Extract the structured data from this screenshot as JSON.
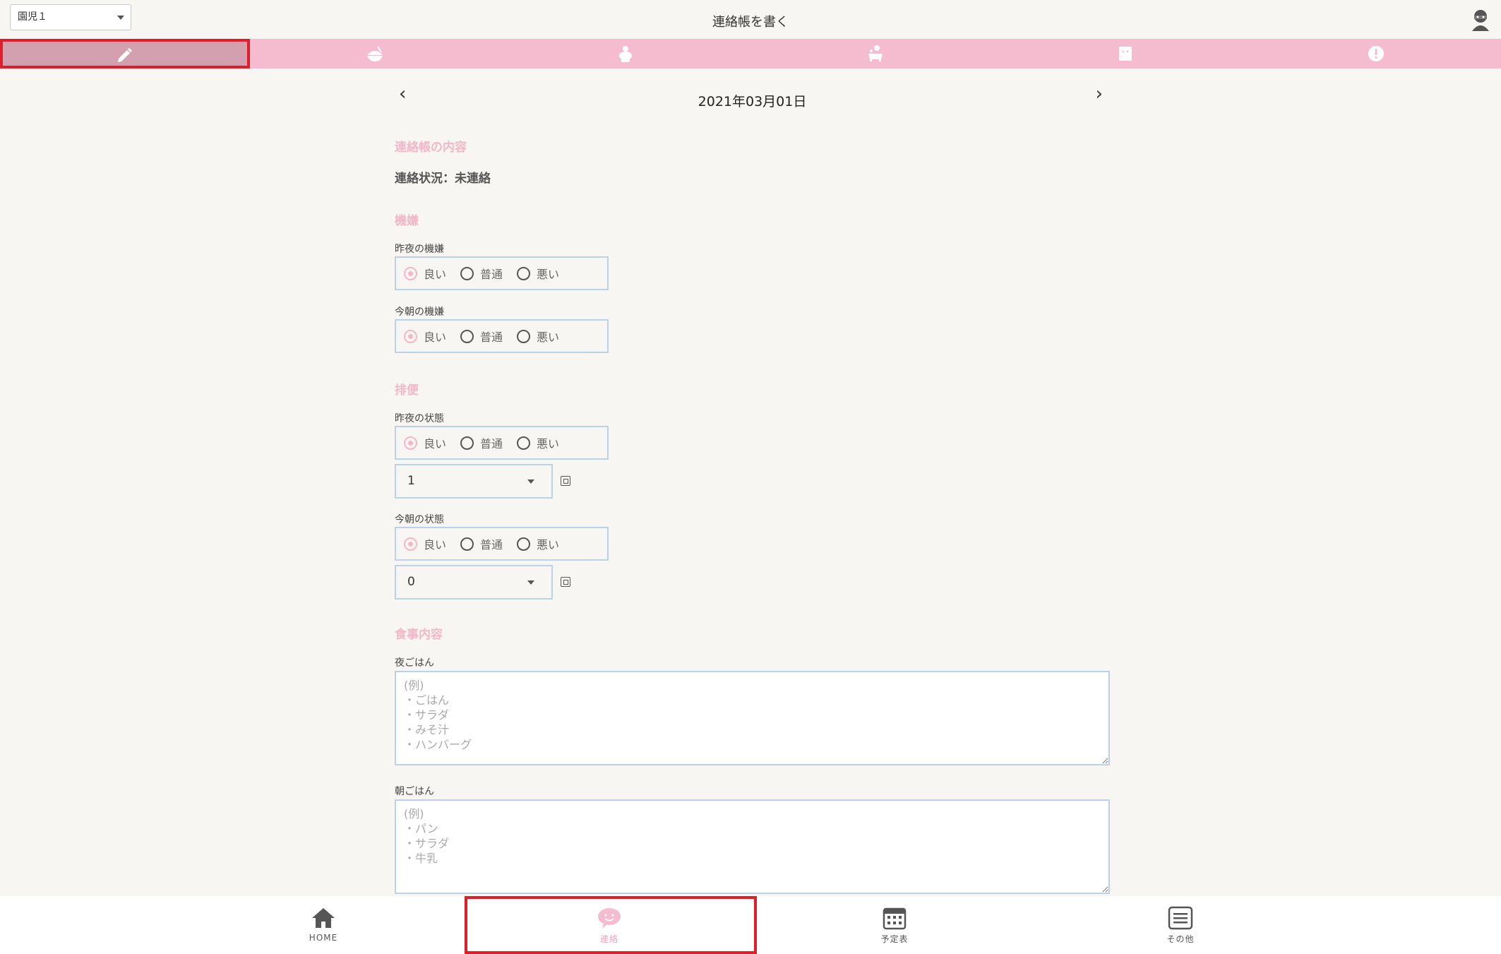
{
  "header": {
    "child_select": "園児１",
    "title": "連絡帳を書く"
  },
  "tabs": [
    {
      "icon": "pencil-icon",
      "active": true
    },
    {
      "icon": "rice-bowl-icon",
      "active": false
    },
    {
      "icon": "toilet-icon",
      "active": false
    },
    {
      "icon": "bath-icon",
      "active": false
    },
    {
      "icon": "note-icon",
      "active": false
    },
    {
      "icon": "alert-icon",
      "active": false
    }
  ],
  "date_nav": {
    "prev": "‹",
    "date": "2021年03月01日",
    "next": "›"
  },
  "sections": {
    "contents_title": "連絡帳の内容",
    "status": "連絡状況：未連絡",
    "mood_title": "機嫌",
    "stool_title": "排便",
    "meal_title": "食事内容"
  },
  "mood": {
    "last_night_label": "昨夜の機嫌",
    "this_morning_label": "今朝の機嫌"
  },
  "stool": {
    "last_night_label": "昨夜の状態",
    "last_night_count": "1",
    "this_morning_label": "今朝の状態",
    "this_morning_count": "0"
  },
  "radio_options": {
    "good": "良い",
    "normal": "普通",
    "bad": "悪い"
  },
  "meals": {
    "dinner_label": "夜ごはん",
    "dinner_placeholder": "(例)\n・ごはん\n・サラダ\n・みそ汁\n・ハンバーグ",
    "breakfast_label": "朝ごはん",
    "breakfast_placeholder": "(例)\n・パン\n・サラダ\n・牛乳"
  },
  "bottom_nav": [
    {
      "label": "HOME",
      "icon": "home-icon",
      "active": false
    },
    {
      "label": "連絡",
      "icon": "smile-bubble-icon",
      "active": true
    },
    {
      "label": "予定表",
      "icon": "calendar-icon",
      "active": false
    },
    {
      "label": "その他",
      "icon": "menu-icon",
      "active": false
    }
  ],
  "colors": {
    "tab_bar": "#f5bcd0",
    "tab_active": "#d3a0b0",
    "section_title": "#f3b6ca",
    "field_border": "#b7d2ea",
    "highlight_outline": "#e01e2a"
  }
}
